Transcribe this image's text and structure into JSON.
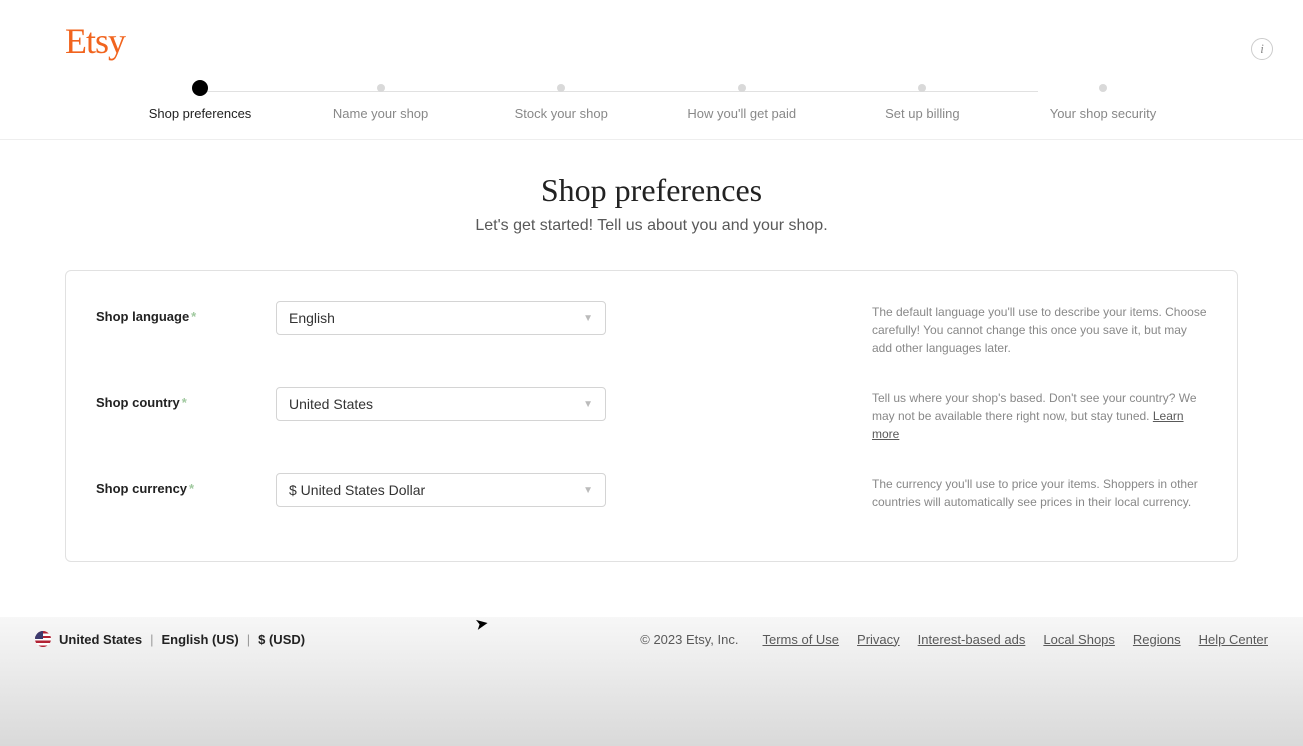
{
  "logo": "Etsy",
  "stepper": {
    "steps": [
      {
        "label": "Shop preferences",
        "active": true
      },
      {
        "label": "Name your shop",
        "active": false
      },
      {
        "label": "Stock your shop",
        "active": false
      },
      {
        "label": "How you'll get paid",
        "active": false
      },
      {
        "label": "Set up billing",
        "active": false
      },
      {
        "label": "Your shop security",
        "active": false
      }
    ]
  },
  "page": {
    "title": "Shop preferences",
    "subtitle": "Let's get started! Tell us about you and your shop."
  },
  "form": {
    "language": {
      "label": "Shop language",
      "value": "English",
      "help": "The default language you'll use to describe your items. Choose carefully! You cannot change this once you save it, but may add other languages later."
    },
    "country": {
      "label": "Shop country",
      "value": "United States",
      "help": "Tell us where your shop's based. Don't see your country? We may not be available there right now, but stay tuned.",
      "learn_more": "Learn more"
    },
    "currency": {
      "label": "Shop currency",
      "value": "$ United States Dollar",
      "help": "The currency you'll use to price your items. Shoppers in other countries will automatically see prices in their local currency."
    }
  },
  "footer": {
    "country": "United States",
    "language": "English (US)",
    "currency": "$ (USD)",
    "copyright": "© 2023 Etsy, Inc.",
    "links": {
      "terms": "Terms of Use",
      "privacy": "Privacy",
      "ads": "Interest-based ads",
      "local": "Local Shops",
      "regions": "Regions",
      "help": "Help Center"
    }
  },
  "info_glyph": "i"
}
